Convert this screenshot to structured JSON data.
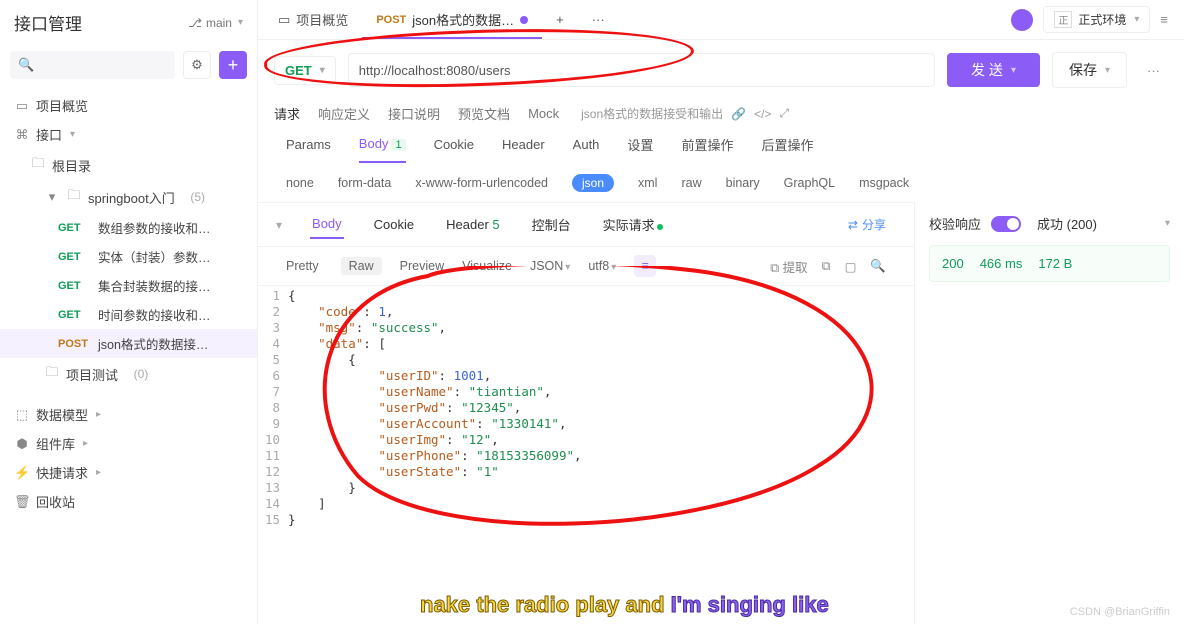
{
  "sidebar": {
    "title": "接口管理",
    "branch": "main",
    "overview": "项目概览",
    "api_root": "接口",
    "root_folder": "根目录",
    "folder1": {
      "name": "springboot入门",
      "count": "(5)"
    },
    "items": [
      {
        "method": "GET",
        "label": "数组参数的接收和…"
      },
      {
        "method": "GET",
        "label": "实体（封装）参数…"
      },
      {
        "method": "GET",
        "label": "集合封装数据的接…"
      },
      {
        "method": "GET",
        "label": "时间参数的接收和…"
      },
      {
        "method": "POST",
        "label": "json格式的数据接…"
      }
    ],
    "folder_test": {
      "name": "项目测试",
      "count": "(0)"
    },
    "data_model": "数据模型",
    "components": "组件库",
    "quick_req": "快捷请求",
    "recycle": "回收站"
  },
  "tabs": {
    "overview": "项目概览",
    "active_method": "POST",
    "active_label": "json格式的数据…"
  },
  "env": {
    "label": "正式环境",
    "badge": "正"
  },
  "request": {
    "method": "GET",
    "url": "http://localhost:8080/users",
    "send": "发 送",
    "save": "保存"
  },
  "subtabs": {
    "req": "请求",
    "resp_def": "响应定义",
    "api_doc": "接口说明",
    "preview_doc": "预览文档",
    "mock": "Mock",
    "extra_label": "json格式的数据接受和输出"
  },
  "param_tabs": {
    "params": "Params",
    "body": "Body",
    "body_badge": "1",
    "cookie": "Cookie",
    "header": "Header",
    "auth": "Auth",
    "settings": "设置",
    "pre": "前置操作",
    "post": "后置操作"
  },
  "body_types": {
    "none": "none",
    "form": "form-data",
    "xwww": "x-www-form-urlencoded",
    "json": "json",
    "xml": "xml",
    "raw": "raw",
    "binary": "binary",
    "graphql": "GraphQL",
    "msgpack": "msgpack"
  },
  "resp_tabs": {
    "body": "Body",
    "cookie": "Cookie",
    "header": "Header",
    "header_badge": "5",
    "console": "控制台",
    "actual": "实际请求",
    "share": "分享"
  },
  "view_bar": {
    "pretty": "Pretty",
    "raw": "Raw",
    "preview": "Preview",
    "visualize": "Visualize",
    "json": "JSON",
    "utf8": "utf8",
    "extract": "提取"
  },
  "response_json": {
    "lines": [
      "{",
      "    \"code\": 1,",
      "    \"msg\": \"success\",",
      "    \"data\": [",
      "        {",
      "            \"userID\": 1001,",
      "            \"userName\": \"tiantian\",",
      "            \"userPwd\": \"12345\",",
      "            \"userAccount\": \"1330141\",",
      "            \"userImg\": \"12\",",
      "            \"userPhone\": \"18153356099\",",
      "            \"userState\": \"1\"",
      "        }",
      "    ]",
      "}"
    ]
  },
  "side_panel": {
    "validate": "校验响应",
    "success_label": "成功 (200)",
    "status_code": "200",
    "time": "466 ms",
    "size": "172 B"
  },
  "watermark": "CSDN @BrianGriffin",
  "song_p1": "nake the radio play and ",
  "song_p2": "I'm singing like"
}
